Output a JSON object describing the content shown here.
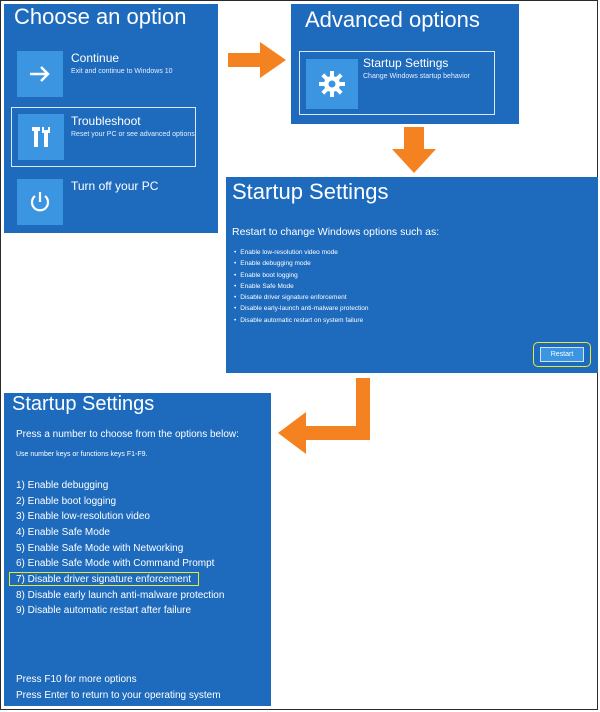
{
  "panel1": {
    "title": "Choose an option",
    "tiles": [
      {
        "label": "Continue",
        "sub": "Exit and continue to Windows 10",
        "icon": "arrow-right-icon"
      },
      {
        "label": "Troubleshoot",
        "sub": "Reset your PC or see advanced options",
        "icon": "tools-icon"
      },
      {
        "label": "Turn off your PC",
        "sub": "",
        "icon": "power-icon"
      }
    ]
  },
  "panel2": {
    "title": "Advanced options",
    "tile": {
      "label": "Startup Settings",
      "sub": "Change Windows startup behavior",
      "icon": "gear-icon"
    }
  },
  "panel3": {
    "title": "Startup Settings",
    "subtitle": "Restart to change Windows options such as:",
    "options": [
      "Enable low-resolution video mode",
      "Enable debugging mode",
      "Enable boot logging",
      "Enable Safe Mode",
      "Disable driver signature enforcement",
      "Disable early-launch anti-malware protection",
      "Disable automatic restart on system failure"
    ],
    "restart_label": "Restart"
  },
  "panel4": {
    "title": "Startup Settings",
    "prompt": "Press a number to choose from the options below:",
    "hint": "Use number keys or functions keys F1-F9.",
    "options": [
      "1) Enable debugging",
      "2) Enable boot logging",
      "3) Enable low-resolution video",
      "4) Enable Safe Mode",
      "5) Enable Safe Mode with Networking",
      "6) Enable Safe Mode with Command Prompt",
      "7) Disable driver signature enforcement",
      "8) Disable early launch anti-malware protection",
      "9) Disable automatic restart after failure"
    ],
    "footer1": "Press F10 for more options",
    "footer2": "Press Enter to return to your operating system"
  },
  "colors": {
    "panel_bg": "#1e6bbd",
    "tile_icon_bg": "#3b95e0",
    "arrow": "#f58220",
    "highlight": "#e8e832"
  }
}
